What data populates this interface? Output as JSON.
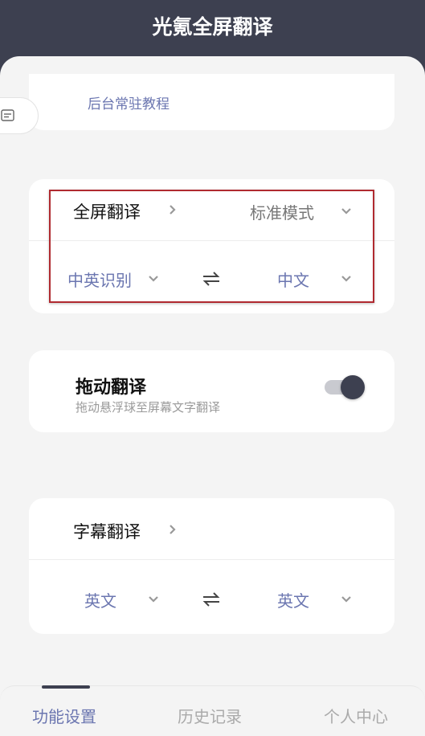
{
  "app": {
    "title": "光氪全屏翻译"
  },
  "top_card": {
    "tutorial_link": "后台常驻教程"
  },
  "fullscreen": {
    "label": "全屏翻译",
    "mode": "标准模式",
    "source_lang": "中英识别",
    "target_lang": "中文"
  },
  "drag": {
    "title": "拖动翻译",
    "subtitle": "拖动悬浮球至屏幕文字翻译",
    "enabled": true
  },
  "subtitle_translate": {
    "label": "字幕翻译",
    "source_lang": "英文",
    "target_lang": "英文"
  },
  "tabs": [
    {
      "label": "功能设置",
      "active": true
    },
    {
      "label": "历史记录",
      "active": false
    },
    {
      "label": "个人中心",
      "active": false
    }
  ],
  "colors": {
    "header": "#3d4050",
    "accent": "#6b76b0",
    "highlight": "#b02a30"
  }
}
